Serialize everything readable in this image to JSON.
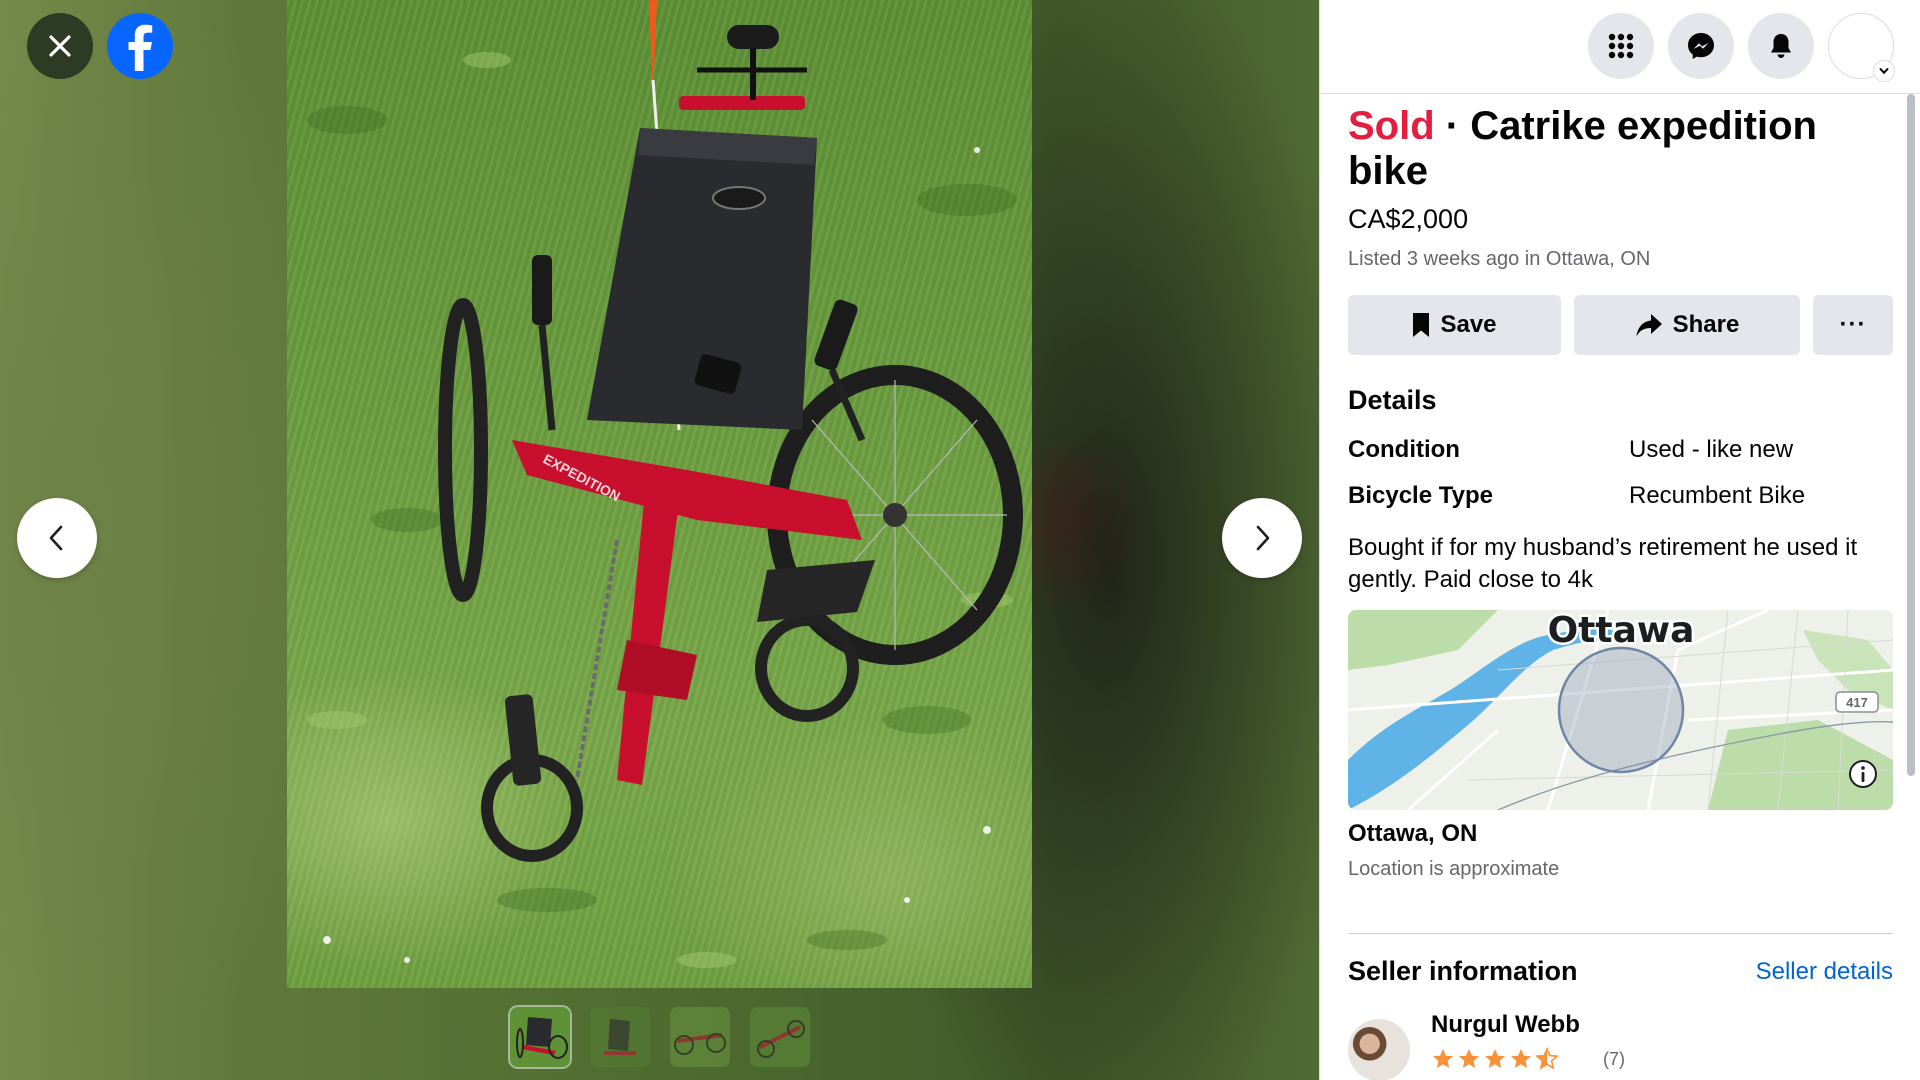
{
  "viewer": {
    "close_icon": "close-icon",
    "logo_icon": "facebook-logo-icon",
    "prev_icon": "chevron-left-icon",
    "next_icon": "chevron-right-icon",
    "photo_colors": {
      "frame": "#c8102e",
      "seat": "#2a2b2e",
      "grass": "#6a9c3e"
    },
    "thumbnails": [
      {
        "label": ""
      },
      {
        "label": ""
      },
      {
        "label": ""
      },
      {
        "label": ""
      }
    ]
  },
  "header": {
    "icons": [
      "menu-grid-icon",
      "messenger-icon",
      "notifications-bell-icon",
      "profile-avatar"
    ]
  },
  "listing": {
    "status": "Sold",
    "separator": " · ",
    "title": "Catrike expedition bike",
    "price": "CA$2,000",
    "listed": "Listed 3 weeks ago in Ottawa, ON",
    "actions": {
      "save_label": "Save",
      "share_label": "Share",
      "more_label": "···"
    },
    "details": {
      "heading": "Details",
      "rows": [
        {
          "label": "Condition",
          "value": "Used - like new"
        },
        {
          "label": "Bicycle Type",
          "value": "Recumbent Bike"
        }
      ]
    },
    "description": "Bought if for my husband’s retirement he used it gently. Paid close to 4k",
    "map": {
      "city_label": "Ottawa",
      "highway_label": "417",
      "info_icon": "info-icon",
      "colors": {
        "water": "#5fb3e6",
        "land": "#eef0ea",
        "park": "#bcdcaa"
      }
    },
    "location_name": "Ottawa, ON",
    "location_note": "Location is approximate"
  },
  "seller": {
    "heading": "Seller information",
    "details_link": "Seller details",
    "name": "Nurgul Webb",
    "rating_stars": 4.5,
    "rating_count": "(7)"
  },
  "colors": {
    "sold": "#e41e3f",
    "link": "#0064d1",
    "star": "#f7923b",
    "button_bg": "#e4e6eb"
  }
}
